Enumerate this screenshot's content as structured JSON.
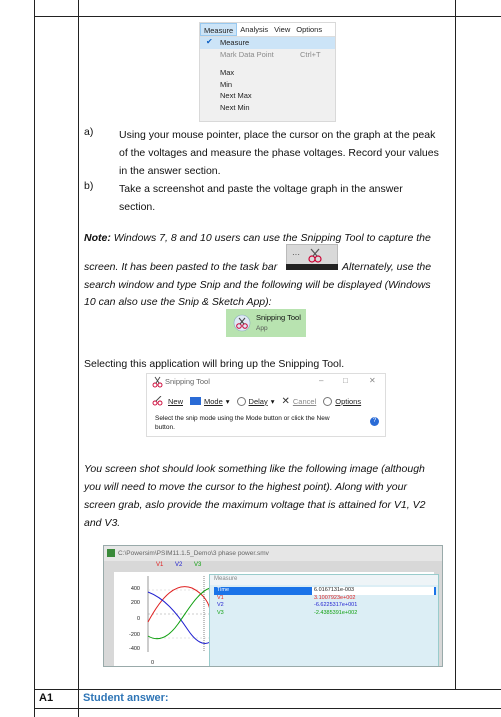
{
  "menu": {
    "bar": [
      "Measure",
      "Analysis",
      "View",
      "Options"
    ],
    "items": [
      {
        "label": "Measure",
        "checked": true
      },
      {
        "label": "Mark Data Point",
        "shortcut": "Ctrl+T",
        "disabled": true
      },
      {
        "label": "Max"
      },
      {
        "label": "Min"
      },
      {
        "label": "Next Max"
      },
      {
        "label": "Next Min"
      }
    ]
  },
  "steps": {
    "a_letter": "a)",
    "a_line1": "Using your mouse pointer, place the cursor on the graph at the peak",
    "a_line2": "of the voltages and measure the phase voltages. Record your values",
    "a_line3": "in the answer section.",
    "b_letter": "b)",
    "b_line1": "Take a screenshot and paste the voltage graph in the answer",
    "b_line2": "section."
  },
  "note": {
    "label": "Note:",
    "line1": " Windows 7, 8 and 10 users can use the Snipping Tool to capture the",
    "line2a": "screen. It has been pasted to the task bar",
    "line2b": "Alternately, use the",
    "line3": "search window and type Snip and the following will be displayed (Windows",
    "line4": "10 can also use the Snip & Sketch App):"
  },
  "snip_app": {
    "name": "Snipping Tool",
    "sub": "App"
  },
  "selecting_text": "Selecting this application will bring up the Snipping Tool.",
  "snip_window": {
    "title": "Snipping Tool",
    "buttons": [
      "New",
      "Mode",
      "Delay",
      "Cancel",
      "Options"
    ],
    "message": "Select the snip mode using the Mode button or click the New button.",
    "controls": [
      "–",
      "□",
      "✕"
    ]
  },
  "screenshot_text": {
    "line1": "You screen shot should look something like the following image (although",
    "line2": "you will need to move the cursor to the highest point). Along with your",
    "line3": "screen grab, aslo provide the maximum voltage that is attained for V1, V2",
    "line4": "and V3."
  },
  "psim": {
    "title": "C:\\Powersim\\PSIM11.1.5_Demo\\3 phase power.smv",
    "legend": [
      "V1",
      "V2",
      "V3"
    ],
    "yticks": [
      "400",
      "200",
      "0",
      "-200",
      "-400"
    ],
    "xtick": "0",
    "measure_title": "Measure",
    "rows": [
      {
        "k": "Time",
        "v": "6.0167131e-003"
      },
      {
        "k": "V1",
        "v": "3.1007923e+002"
      },
      {
        "k": "V2",
        "v": "-6.6225317e+001"
      },
      {
        "k": "V3",
        "v": "-2.4385391e+002"
      }
    ]
  },
  "footer": {
    "id": "A1",
    "label": "Student answer:"
  },
  "colors": {
    "v1": "#e02020",
    "v2": "#2020d0",
    "v3": "#10a010",
    "student": "#2e75b6"
  }
}
